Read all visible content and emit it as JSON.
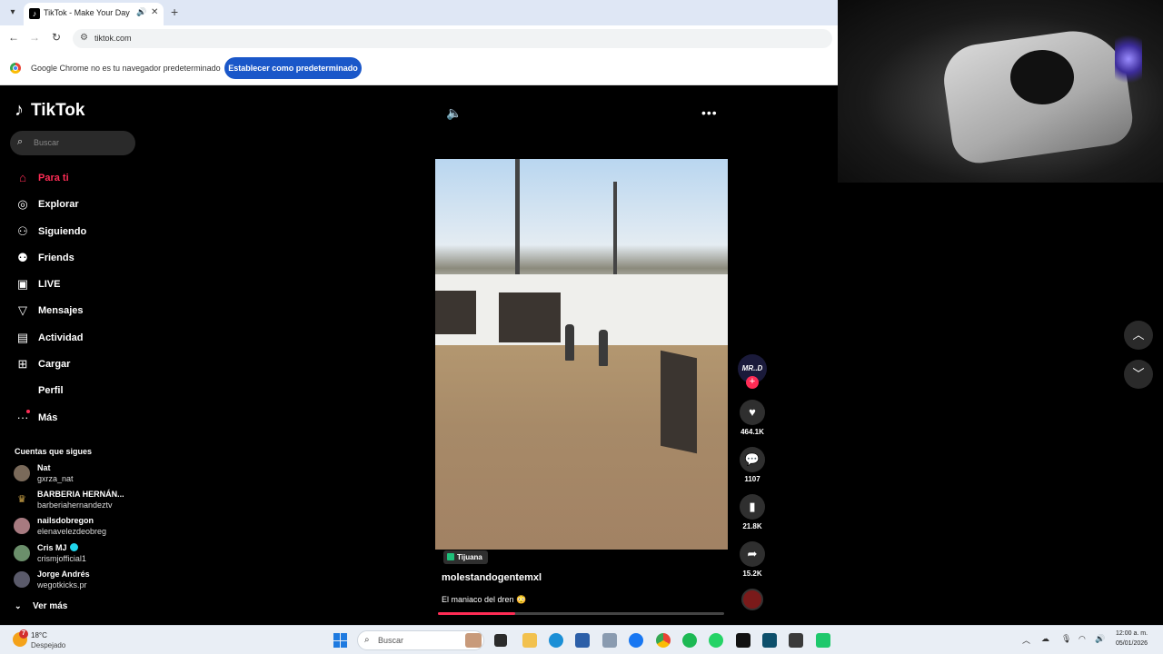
{
  "browser": {
    "tab_title": "TikTok - Make Your Day",
    "tab_favicon": "tiktok-icon",
    "url": "tiktok.com",
    "infobar_message": "Google Chrome no es tu navegador predeterminado",
    "infobar_button": "Establecer como predeterminado"
  },
  "tiktok": {
    "logo_text": "TikTok",
    "search_placeholder": "Buscar",
    "nav": [
      {
        "label": "Para ti",
        "icon": "home-icon",
        "active": true
      },
      {
        "label": "Explorar",
        "icon": "compass-icon"
      },
      {
        "label": "Siguiendo",
        "icon": "user-plus-icon"
      },
      {
        "label": "Friends",
        "icon": "friends-icon"
      },
      {
        "label": "LIVE",
        "icon": "live-icon"
      },
      {
        "label": "Mensajes",
        "icon": "message-icon"
      },
      {
        "label": "Actividad",
        "icon": "activity-icon"
      },
      {
        "label": "Cargar",
        "icon": "upload-icon"
      },
      {
        "label": "Perfil",
        "icon": ""
      },
      {
        "label": "Más",
        "icon": "more-icon"
      }
    ],
    "following_title": "Cuentas que sigues",
    "following": [
      {
        "name": "Nat",
        "handle": "gxrza_nat",
        "verified": false
      },
      {
        "name": "BARBERIA HERNÁN...",
        "handle": "barberiahernandeztv",
        "verified": false
      },
      {
        "name": "nailsdobregon",
        "handle": "elenavelezdeobreg",
        "verified": false
      },
      {
        "name": "Cris MJ",
        "handle": "crismjofficial1",
        "verified": true
      },
      {
        "name": "Jorge Andrés",
        "handle": "wegotkicks.pr",
        "verified": false
      }
    ],
    "see_more": "Ver más",
    "video": {
      "location": "Tijuana",
      "author": "molestandogentemxl",
      "description": "El maniaco del dren 😳",
      "progress": 0.27,
      "creator_avatar_text": "MR..D",
      "likes": "464.1K",
      "comments": "1107",
      "saves": "21.8K",
      "shares": "15.2K"
    }
  },
  "taskbar": {
    "weather_temp": "18°C",
    "weather_desc": "Despejado",
    "weather_badge": "7",
    "search_placeholder": "Buscar",
    "time": "12:00 a. m.",
    "date": "05/01/2026"
  },
  "colors": {
    "accent": "#fe2c55",
    "chrome_blue": "#1a57c9"
  }
}
